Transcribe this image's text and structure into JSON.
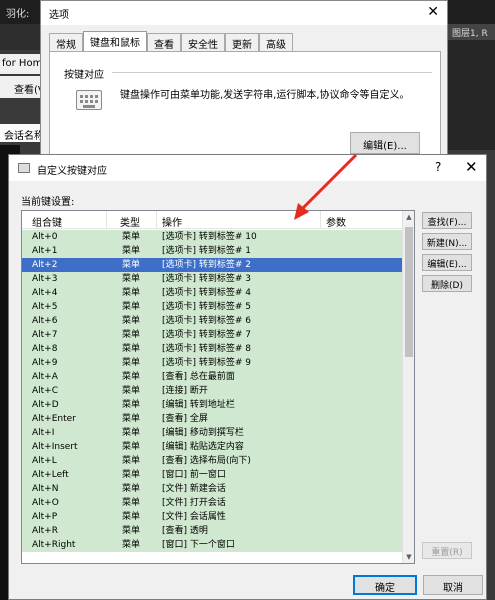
{
  "background": {
    "title": "羽化:",
    "home": "for Home",
    "menu_view": "查看(V)",
    "session_name": "会话名称",
    "right_tab": "图层1, R"
  },
  "options_dialog": {
    "title": "选项",
    "tabs": [
      "常规",
      "键盘和鼠标",
      "查看",
      "安全性",
      "更新",
      "高级"
    ],
    "active_tab": 1,
    "section_label": "按键对应",
    "description": "键盘操作可由菜单功能,发送字符串,运行脚本,协议命令等自定义。",
    "edit_button": "编辑(E)..."
  },
  "dialog": {
    "title": "自定义按键对应",
    "help": "?",
    "close": "✕",
    "current_label": "当前键设置:",
    "columns": [
      "组合键",
      "类型",
      "操作",
      "参数"
    ],
    "selected_index": 2,
    "rows": [
      {
        "key": "Alt+0",
        "type": "菜单",
        "action": "[选项卡] 转到标签# 10",
        "param": ""
      },
      {
        "key": "Alt+1",
        "type": "菜单",
        "action": "[选项卡] 转到标签# 1",
        "param": ""
      },
      {
        "key": "Alt+2",
        "type": "菜单",
        "action": "[选项卡] 转到标签# 2",
        "param": ""
      },
      {
        "key": "Alt+3",
        "type": "菜单",
        "action": "[选项卡] 转到标签# 3",
        "param": ""
      },
      {
        "key": "Alt+4",
        "type": "菜单",
        "action": "[选项卡] 转到标签# 4",
        "param": ""
      },
      {
        "key": "Alt+5",
        "type": "菜单",
        "action": "[选项卡] 转到标签# 5",
        "param": ""
      },
      {
        "key": "Alt+6",
        "type": "菜单",
        "action": "[选项卡] 转到标签# 6",
        "param": ""
      },
      {
        "key": "Alt+7",
        "type": "菜单",
        "action": "[选项卡] 转到标签# 7",
        "param": ""
      },
      {
        "key": "Alt+8",
        "type": "菜单",
        "action": "[选项卡] 转到标签# 8",
        "param": ""
      },
      {
        "key": "Alt+9",
        "type": "菜单",
        "action": "[选项卡] 转到标签# 9",
        "param": ""
      },
      {
        "key": "Alt+A",
        "type": "菜单",
        "action": "[查看] 总在最前面",
        "param": ""
      },
      {
        "key": "Alt+C",
        "type": "菜单",
        "action": "[连接] 断开",
        "param": ""
      },
      {
        "key": "Alt+D",
        "type": "菜单",
        "action": "[编辑] 转到地址栏",
        "param": ""
      },
      {
        "key": "Alt+Enter",
        "type": "菜单",
        "action": "[查看] 全屏",
        "param": ""
      },
      {
        "key": "Alt+I",
        "type": "菜单",
        "action": "[编辑] 移动到撰写栏",
        "param": ""
      },
      {
        "key": "Alt+Insert",
        "type": "菜单",
        "action": "[编辑] 粘贴选定内容",
        "param": ""
      },
      {
        "key": "Alt+L",
        "type": "菜单",
        "action": "[查看] 选择布局(向下)",
        "param": ""
      },
      {
        "key": "Alt+Left",
        "type": "菜单",
        "action": "[窗口] 前一窗口",
        "param": ""
      },
      {
        "key": "Alt+N",
        "type": "菜单",
        "action": "[文件] 新建会话",
        "param": ""
      },
      {
        "key": "Alt+O",
        "type": "菜单",
        "action": "[文件] 打开会话",
        "param": ""
      },
      {
        "key": "Alt+P",
        "type": "菜单",
        "action": "[文件] 会话属性",
        "param": ""
      },
      {
        "key": "Alt+R",
        "type": "菜单",
        "action": "[查看] 透明",
        "param": ""
      },
      {
        "key": "Alt+Right",
        "type": "菜单",
        "action": "[窗口] 下一个窗口",
        "param": ""
      }
    ],
    "buttons": {
      "find": "查找(F)...",
      "new": "新建(N)...",
      "edit": "编辑(E)...",
      "delete": "删除(D)",
      "reset": "重置(R)",
      "ok": "确定",
      "cancel": "取消"
    }
  },
  "colors": {
    "row_green": "#cfe8cf",
    "selection": "#3d6fc9",
    "arrow": "#e32b1f"
  }
}
